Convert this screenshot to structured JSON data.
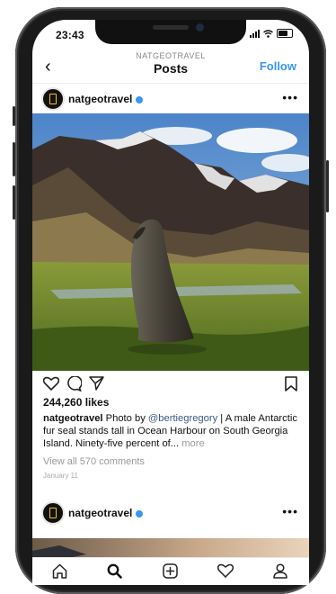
{
  "status_bar": {
    "time": "23:43"
  },
  "nav": {
    "subtitle": "NATGEOTRAVEL",
    "title": "Posts",
    "follow_label": "Follow",
    "back_icon": "chevron-left-icon"
  },
  "post": {
    "username": "natgeotravel",
    "likes": "244,260 likes",
    "caption": {
      "username": "natgeotravel",
      "text_before_mention": "Photo by ",
      "mention": "@bertiegregory",
      "text_after_mention": " | A male Antarctic fur seal stands tall in Ocean Harbour on South Georgia Island. Ninety-five percent of... ",
      "more_label": "more"
    },
    "view_comments": "View all 570 comments",
    "date": "January 11",
    "image_description_icon": "fur-seal-photo"
  },
  "post2": {
    "username": "natgeotravel"
  },
  "tab_bar": [
    "home-icon",
    "search-icon",
    "add-icon",
    "heart-icon",
    "profile-icon"
  ],
  "colors": {
    "link_blue": "#3897f0",
    "mention_blue": "#3a5a86",
    "muted_gray": "#999999"
  }
}
